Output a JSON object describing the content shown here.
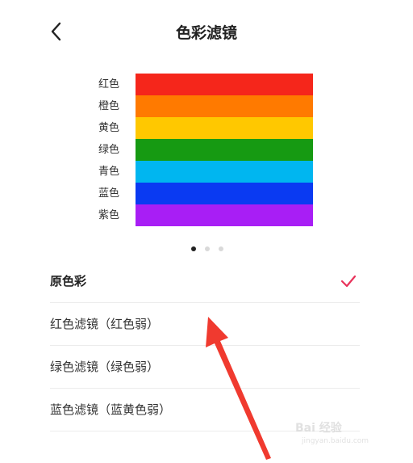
{
  "header": {
    "title": "色彩滤镜"
  },
  "color_bands": [
    {
      "label": "红色",
      "color": "#f5261b"
    },
    {
      "label": "橙色",
      "color": "#ff7a00"
    },
    {
      "label": "黄色",
      "color": "#ffc800"
    },
    {
      "label": "绿色",
      "color": "#169a12"
    },
    {
      "label": "青色",
      "color": "#00b6f0"
    },
    {
      "label": "蓝色",
      "color": "#0a3af2"
    },
    {
      "label": "紫色",
      "color": "#a81ef5"
    }
  ],
  "pagination": {
    "total": 3,
    "active_index": 0
  },
  "options": [
    {
      "label": "原色彩",
      "selected": true
    },
    {
      "label": "红色滤镜（红色弱）",
      "selected": false
    },
    {
      "label": "绿色滤镜（绿色弱）",
      "selected": false
    },
    {
      "label": "蓝色滤镜（蓝黄色弱）",
      "selected": false
    }
  ],
  "colors": {
    "accent": "#e8325a",
    "annotation_arrow": "#f03a2f"
  },
  "watermark": {
    "logo": "Bai 经验",
    "url": "jingyan.baidu.com"
  }
}
